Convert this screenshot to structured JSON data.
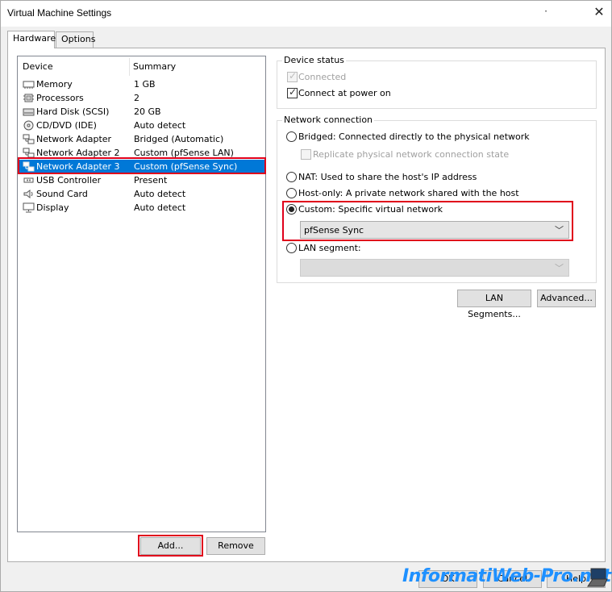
{
  "window": {
    "title": "Virtual Machine Settings"
  },
  "tabs": [
    {
      "label": "Hardware"
    },
    {
      "label": "Options"
    }
  ],
  "device_list": {
    "headers": {
      "device": "Device",
      "summary": "Summary"
    },
    "rows": [
      {
        "device": "Memory",
        "summary": "1 GB",
        "icon": "memory-icon"
      },
      {
        "device": "Processors",
        "summary": "2",
        "icon": "processor-icon"
      },
      {
        "device": "Hard Disk (SCSI)",
        "summary": "20 GB",
        "icon": "hard-disk-icon"
      },
      {
        "device": "CD/DVD (IDE)",
        "summary": "Auto detect",
        "icon": "cd-dvd-icon"
      },
      {
        "device": "Network Adapter",
        "summary": "Bridged (Automatic)",
        "icon": "network-adapter-icon"
      },
      {
        "device": "Network Adapter 2",
        "summary": "Custom (pfSense LAN)",
        "icon": "network-adapter-icon"
      },
      {
        "device": "Network Adapter 3",
        "summary": "Custom (pfSense Sync)",
        "icon": "network-adapter-icon",
        "selected": true
      },
      {
        "device": "USB Controller",
        "summary": "Present",
        "icon": "usb-icon"
      },
      {
        "device": "Sound Card",
        "summary": "Auto detect",
        "icon": "sound-icon"
      },
      {
        "device": "Display",
        "summary": "Auto detect",
        "icon": "display-icon"
      }
    ]
  },
  "device_buttons": {
    "add": "Add...",
    "remove": "Remove"
  },
  "device_status": {
    "title": "Device status",
    "connected": {
      "label": "Connected",
      "checked": true,
      "disabled": true
    },
    "connect_at_power_on": {
      "label": "Connect at power on",
      "checked": true
    }
  },
  "network_connection": {
    "title": "Network connection",
    "bridged": {
      "label": "Bridged: Connected directly to the physical network",
      "selected": false
    },
    "replicate": {
      "label": "Replicate physical network connection state",
      "checked": false,
      "disabled": true
    },
    "nat": {
      "label": "NAT: Used to share the host's IP address",
      "selected": false
    },
    "host_only": {
      "label": "Host-only: A private network shared with the host",
      "selected": false
    },
    "custom": {
      "label": "Custom: Specific virtual network",
      "selected": true
    },
    "custom_select": {
      "value": "pfSense Sync"
    },
    "lan_segment": {
      "label": "LAN segment:",
      "selected": false
    },
    "lan_select": {
      "value": ""
    }
  },
  "network_buttons": {
    "lan_segments": "LAN Segments...",
    "advanced": "Advanced..."
  },
  "dialog_buttons": {
    "ok": "OK",
    "cancel": "Cancel",
    "help": "Help"
  },
  "watermark": {
    "text": "InformatiWeb-Pro.net"
  },
  "colors": {
    "selection": "#0078d7",
    "highlight_box": "#e0001b",
    "watermark": "#1e90ff"
  }
}
